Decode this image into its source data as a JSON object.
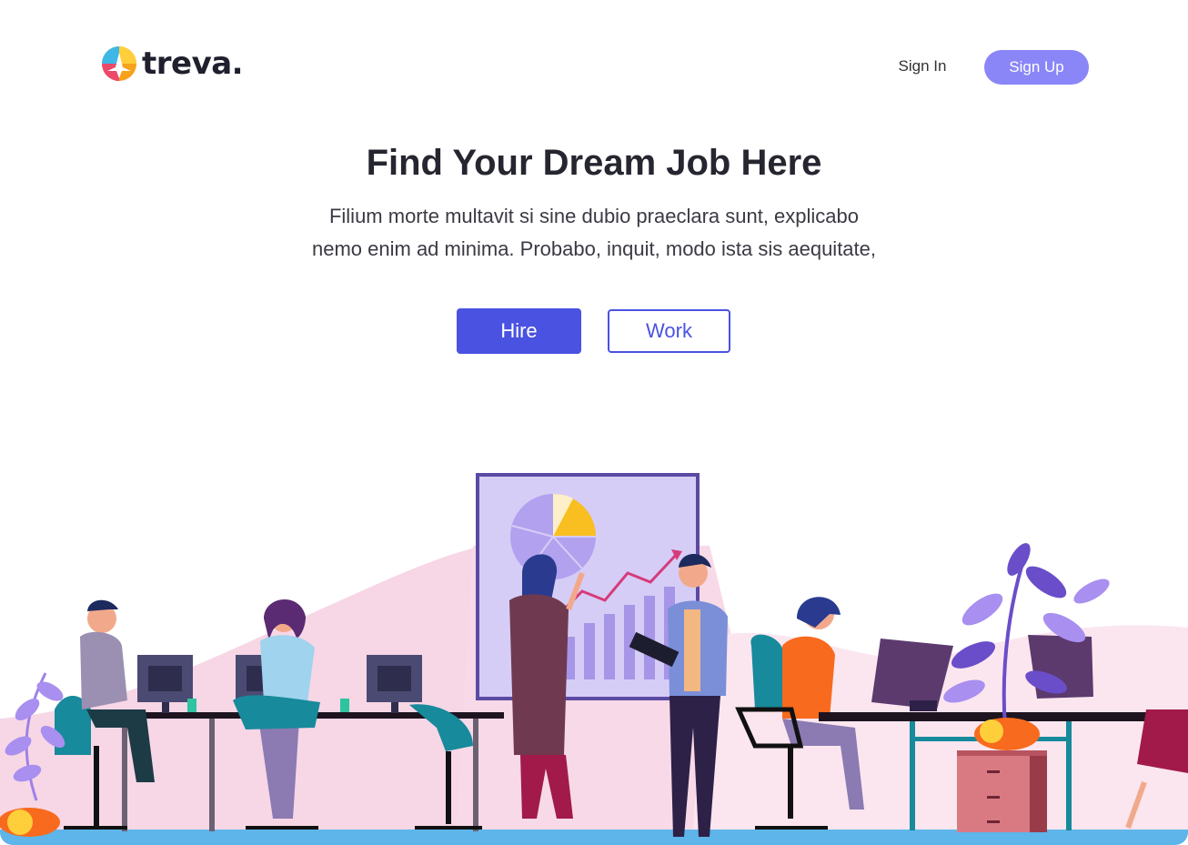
{
  "header": {
    "brand": "treva.",
    "sign_in": "Sign In",
    "sign_up": "Sign Up"
  },
  "hero": {
    "title": "Find Your Dream Job Here",
    "subtitle_line1": "Filium morte multavit si sine dubio praeclara sunt, explicabo",
    "subtitle_line2": "nemo enim ad minima. Probabo, inquit, modo ista sis aequitate,",
    "hire_label": "Hire",
    "work_label": "Work"
  },
  "colors": {
    "primary": "#4a52e1",
    "signup_bg": "#8a86f7",
    "text_dark": "#262631",
    "floor": "#5db5ea"
  },
  "illustration": {
    "name": "office-team-illustration"
  }
}
